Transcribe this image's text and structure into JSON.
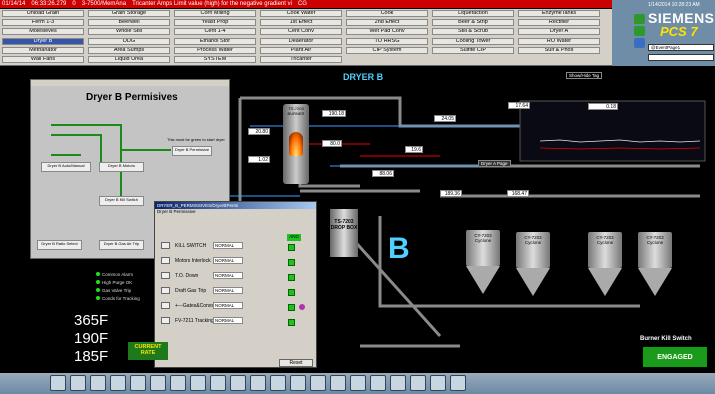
{
  "alarm_bar": {
    "date": "01/14/14",
    "time": "06:33:26.279",
    "count": "0",
    "tag": "3-7500/MemAna",
    "message": "Tricanter Amps Limit value (high) for the negative gradient vi",
    "suffix": "CG"
  },
  "nav": {
    "col1": [
      "Unload Grain",
      "Ferm 1-3",
      "Molesieves",
      "Dryer B",
      "Methanator",
      "Wall Fans"
    ],
    "col2": [
      "Grain Storage",
      "Beerwell",
      "Whole Still",
      "DDG",
      "Area Sumps",
      "Liquid Urea"
    ],
    "col3": [
      "Corn Milling",
      "Yeast Prop",
      "Cent 1-4",
      "Ethanol Stor",
      "Process Water",
      "SYSTEM"
    ],
    "col4": [
      "Cook Water",
      "1st Effect",
      "Cent Conv",
      "Deaerator",
      "Plant Air",
      "Tricanter"
    ],
    "col5": [
      "Cook",
      "2nd Effect",
      "Wet Pad Conv",
      "TO HRSG",
      "CIP System",
      ""
    ],
    "col6": [
      "Liquefaction",
      "Beer & Strip",
      "Still & Scrub",
      "Cooling Tower",
      "Sulfite CIP",
      ""
    ],
    "col7": [
      "EnzymeTanks",
      "Rectifier",
      "Dryer A",
      "RO Water",
      "Sulf & Phos",
      ""
    ],
    "selected": "Dryer B"
  },
  "brand": {
    "clock": "1/14/2014 10:28:23 AM",
    "logo": "SIEMENS",
    "product": "PCS 7",
    "login": "@EventPage1"
  },
  "process": {
    "title": "DRYER B",
    "show_hide": "Show/Hide Tag",
    "burner": "TS-7203 BURNER",
    "drop_box": "TS-7203 DROP BOX",
    "big_letter": "B",
    "cyclones": [
      "CY-7203 Cyclone",
      "CY-7203 Cyclone",
      "CY-7203 Cyclone",
      "CY-7203 Cyclone"
    ],
    "values": [
      "20.80",
      "1.02",
      "190.18",
      "80.0",
      "88.06",
      "19.6",
      "24.05",
      "17.64",
      "0.18",
      "189.36",
      "168.47"
    ],
    "drop_box_label": "Dryer A Page"
  },
  "permissives": {
    "title": "Dryer B Permisives",
    "note": "This must be green to start dryer",
    "blocks": [
      "Dryer B Permissive",
      "Dryer B Auto/Manual",
      "Dryer B Motors",
      "Dryer B Kill Switch",
      "Dryer B Ratio Select",
      "Dryer B Gas Air Trip"
    ]
  },
  "dialog": {
    "title": "DRYER_B_PERMISSIVES/DryerBPermi",
    "subtitle": "Dryer B Permissive",
    "header": "AND",
    "rows": [
      {
        "name": "KILL SWITCH",
        "state": "NORMAL"
      },
      {
        "name": "Motors Interlock",
        "state": "NORMAL"
      },
      {
        "name": "T.O. Down",
        "state": "NORMAL"
      },
      {
        "name": "Draft Gas Trip",
        "state": "NORMAL"
      },
      {
        "name": "+---Gates&Convs",
        "state": "NORMAL"
      },
      {
        "name": "FV-7211 Tracking",
        "state": "NORMAL"
      }
    ],
    "reset": "Reset"
  },
  "legend": [
    "Common Alarm",
    "High Purge OK",
    "Gas Valve Trip",
    "Conds for Tracking"
  ],
  "temps": [
    "365F",
    "190F",
    "185F"
  ],
  "current_rate": "CURRENT RATE",
  "burner_kill": {
    "label": "Burner Kill Switch",
    "state": "ENGAGED"
  }
}
